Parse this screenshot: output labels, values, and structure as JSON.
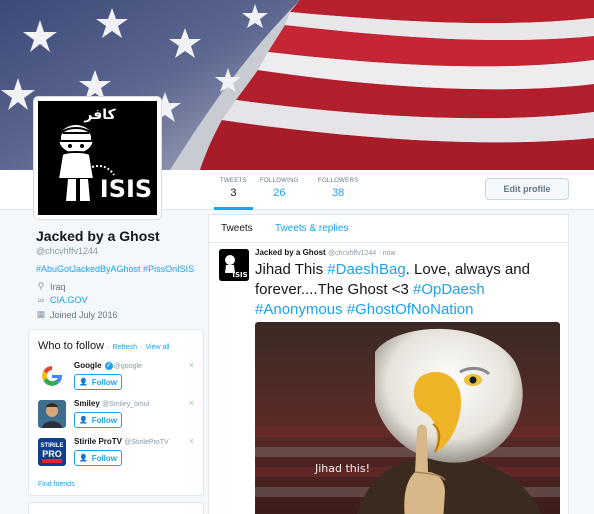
{
  "banner": {
    "alt_icon": "us-flag-image"
  },
  "profile": {
    "avatar_text_top": "كافر",
    "avatar_text_bottom": "ISIS",
    "name": "Jacked by a Ghost",
    "handle": "@chcvhffv1244",
    "bio": "#AbuGotJackedByAGhost #PissOnISIS",
    "location": "Iraq",
    "website": "CIA.GOV",
    "joined": "Joined July 2016"
  },
  "stats": {
    "tweets_label": "TWEETS",
    "tweets_value": "3",
    "following_label": "FOLLOWING",
    "following_value": "26",
    "followers_label": "FOLLOWERS",
    "followers_value": "38"
  },
  "actions": {
    "edit_profile": "Edit profile"
  },
  "who_to_follow": {
    "title": "Who to follow",
    "refresh": "Refresh",
    "separator": "·",
    "view_all": "View all",
    "follow_label": "Follow",
    "find_friends": "Find friends",
    "suggestions": [
      {
        "name": "Google",
        "handle": "@google",
        "verified": true,
        "icon": "google-logo-icon"
      },
      {
        "name": "Smiley",
        "handle": "@Smiley_omul",
        "verified": false,
        "icon": "smiley-avatar"
      },
      {
        "name": "Stirile ProTV",
        "handle": "@StirileProTV",
        "verified": false,
        "icon": "stirile-protv-logo-icon",
        "logo_top": "STIRILE",
        "logo_mid": "PRO"
      }
    ]
  },
  "timeline": {
    "tab_tweets": "Tweets",
    "tab_replies": "Tweets & replies",
    "tweet": {
      "name": "Jacked by a Ghost",
      "handle": "@chcvhffv1244",
      "time": "now",
      "text_1": "Jihad This ",
      "hashtag_1": "#DaeshBag",
      "text_2": ". Love, always and forever....The Ghost <3 ",
      "hashtag_2": "#OpDaesh",
      "hashtag_3": "#Anonymous",
      "hashtag_4": "#GhostOfNoNation",
      "image_caption": "Jihad this!"
    }
  },
  "colors": {
    "accent": "#1da1f2",
    "text": "#14171a",
    "muted": "#657786",
    "border": "#e1e8ed"
  }
}
